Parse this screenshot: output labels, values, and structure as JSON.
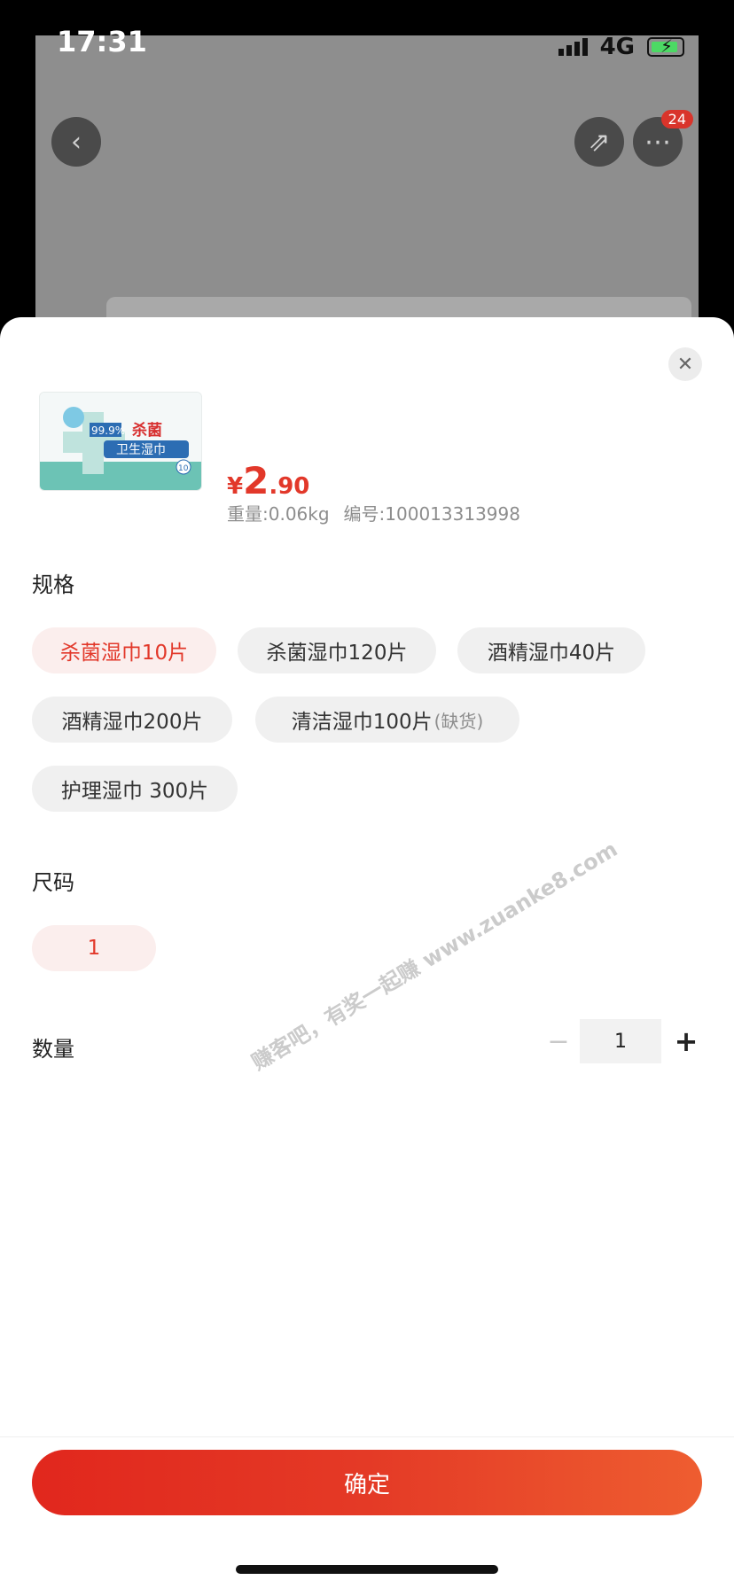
{
  "status_bar": {
    "time": "17:31",
    "network": "4G"
  },
  "header": {
    "badge_count": "24"
  },
  "product": {
    "price_symbol": "¥",
    "price_integer": "2",
    "price_decimal": ".90",
    "weight": "重量:0.06kg",
    "sku": "编号:100013313998",
    "thumb_text_1": "99.9%",
    "thumb_text_2": "杀菌",
    "thumb_text_3": "卫生湿巾",
    "thumb_text_4": "10"
  },
  "spec": {
    "title": "规格",
    "options": [
      {
        "label": "杀菌湿巾10片",
        "selected": true
      },
      {
        "label": "杀菌湿巾120片",
        "selected": false
      },
      {
        "label": "酒精湿巾40片",
        "selected": false
      },
      {
        "label": "酒精湿巾200片",
        "selected": false
      },
      {
        "label": "清洁湿巾100片",
        "status": "(缺货)",
        "selected": false
      },
      {
        "label": "护理湿巾 300片",
        "selected": false
      }
    ]
  },
  "size": {
    "title": "尺码",
    "options": [
      {
        "label": "1",
        "selected": true
      }
    ]
  },
  "quantity": {
    "title": "数量",
    "minus": "−",
    "value": "1",
    "plus": "+"
  },
  "confirm_label": "确定",
  "watermark": "赚客吧，有奖一起赚 www.zuanke8.com",
  "colors": {
    "accent": "#e2382a",
    "selected_bg": "#fbeeed",
    "chip_bg": "#f0f0f0"
  }
}
